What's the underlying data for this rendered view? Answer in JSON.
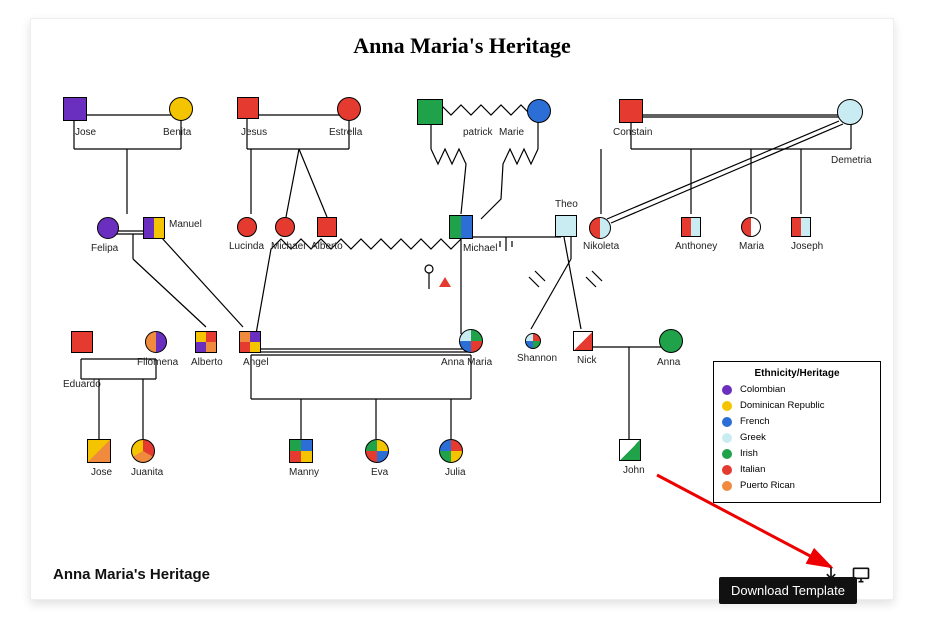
{
  "title": "Anna Maria's Heritage",
  "caption": "Anna Maria's Heritage",
  "tooltip": "Download Template",
  "legend": {
    "heading": "Ethnicity/Heritage",
    "items": [
      {
        "label": "Colombian",
        "color": "#6a2fbf"
      },
      {
        "label": "Dominican Republic",
        "color": "#f5c400"
      },
      {
        "label": "French",
        "color": "#2b6fd6"
      },
      {
        "label": "Greek",
        "color": "#c9ecf2"
      },
      {
        "label": "Irish",
        "color": "#1fa24a"
      },
      {
        "label": "Italian",
        "color": "#e43a2f"
      },
      {
        "label": "Puerto Rican",
        "color": "#f08a3c"
      }
    ]
  },
  "names": {
    "jose": "Jose",
    "benita": "Benita",
    "jesus": "Jesus",
    "estrella": "Estrella",
    "patrick": "patrick",
    "marie": "Marie",
    "constain": "Constain",
    "demetria": "Demetria",
    "felipa": "Felipa",
    "manuel": "Manuel",
    "lucinda": "Lucinda",
    "michael1": "Michael",
    "alberto1": "Alberto",
    "michael2": "Michael",
    "theo": "Theo",
    "nikoleta": "Nikoleta",
    "anthoney": "Anthoney",
    "maria": "Maria",
    "joseph": "Joseph",
    "eduardo": "Eduardo",
    "filomena": "Filomena",
    "alberto2": "Alberto",
    "angel": "Angel",
    "annamaria": "Anna Maria",
    "shannon": "Shannon",
    "nick": "Nick",
    "anna": "Anna",
    "jose2": "Jose",
    "juanita": "Juanita",
    "manny": "Manny",
    "eva": "Eva",
    "julia": "Julia",
    "john": "John"
  },
  "colors": {
    "colombian": "#6a2fbf",
    "dominican": "#f5c400",
    "french": "#2b6fd6",
    "greek": "#c9ecf2",
    "irish": "#1fa24a",
    "italian": "#e43a2f",
    "puerto": "#f08a3c"
  }
}
